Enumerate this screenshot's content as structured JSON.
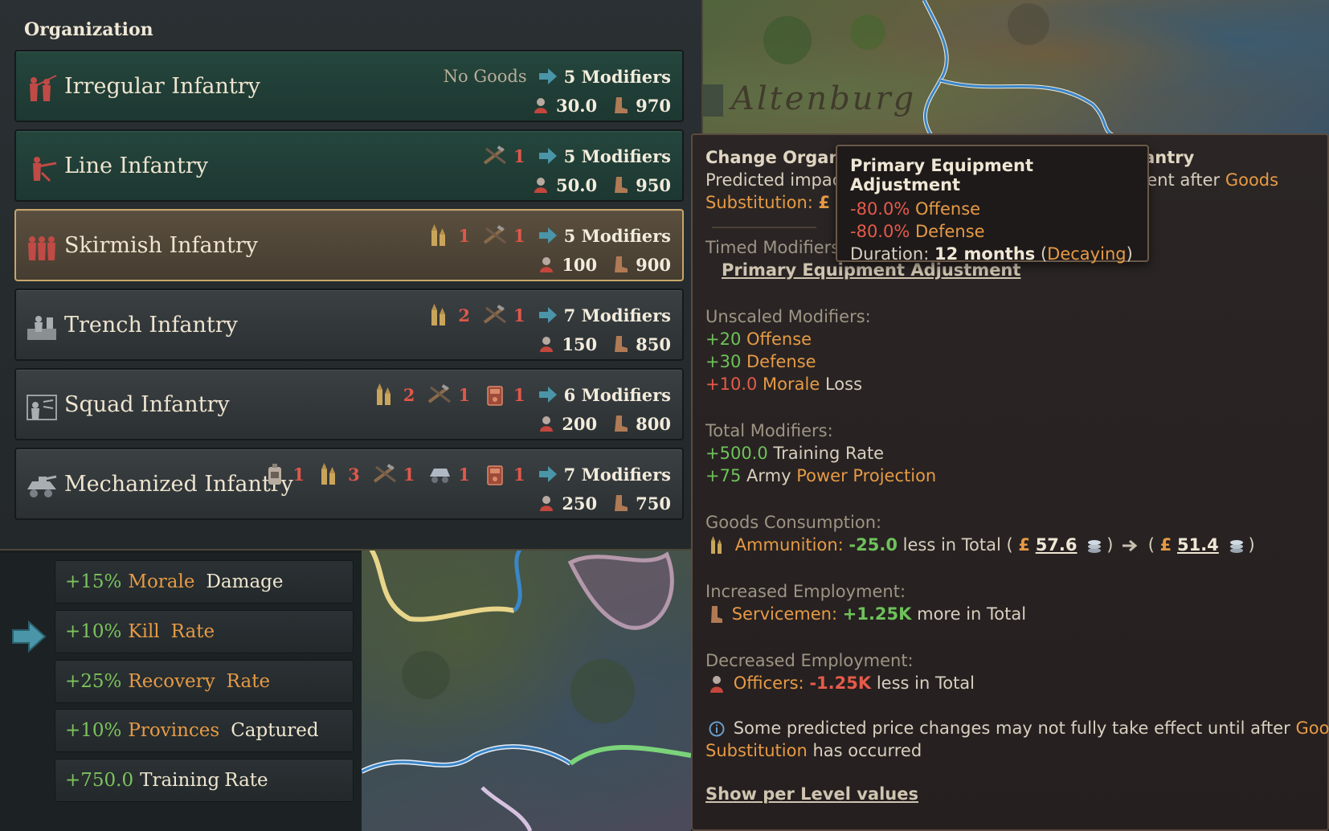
{
  "map": {
    "city_label": "Altenburg"
  },
  "org_panel": {
    "title": "Organization",
    "rows": [
      {
        "name": "Irregular Infantry",
        "no_goods": "No Goods",
        "reqs": [],
        "modifiers": "5 Modifiers",
        "offense": "30.0",
        "manpower": "970"
      },
      {
        "name": "Line Infantry",
        "no_goods": "",
        "reqs": [
          {
            "icon": "rifle-icon",
            "count": "1"
          }
        ],
        "modifiers": "5 Modifiers",
        "offense": "50.0",
        "manpower": "950"
      },
      {
        "name": "Skirmish Infantry",
        "no_goods": "",
        "reqs": [
          {
            "icon": "ammunition-icon",
            "count": "1"
          },
          {
            "icon": "rifle-icon",
            "count": "1"
          }
        ],
        "modifiers": "5 Modifiers",
        "offense": "100",
        "manpower": "900"
      },
      {
        "name": "Trench Infantry",
        "no_goods": "",
        "reqs": [
          {
            "icon": "ammunition-icon",
            "count": "2"
          },
          {
            "icon": "rifle-icon",
            "count": "1"
          }
        ],
        "modifiers": "7 Modifiers",
        "offense": "150",
        "manpower": "850"
      },
      {
        "name": "Squad Infantry",
        "no_goods": "",
        "reqs": [
          {
            "icon": "ammunition-icon",
            "count": "2"
          },
          {
            "icon": "rifle-icon",
            "count": "1"
          },
          {
            "icon": "radio-icon",
            "count": "1"
          }
        ],
        "modifiers": "6 Modifiers",
        "offense": "200",
        "manpower": "800"
      },
      {
        "name": "Mechanized Infantry",
        "no_goods": "",
        "reqs": [
          {
            "icon": "fuel-icon",
            "count": "1"
          },
          {
            "icon": "ammunition-icon",
            "count": "3"
          },
          {
            "icon": "rifle-icon",
            "count": "1"
          },
          {
            "icon": "vehicle-icon",
            "count": "1"
          },
          {
            "icon": "radio-icon",
            "count": "1"
          }
        ],
        "modifiers": "7 Modifiers",
        "offense": "250",
        "manpower": "750"
      }
    ]
  },
  "modifier_list": [
    {
      "value": "+15%",
      "label_a": "Morale",
      "label_b": "Damage"
    },
    {
      "value": "+10%",
      "label_a": "Kill",
      "label_b": "Rate"
    },
    {
      "value": "+25%",
      "label_a": "Recovery",
      "label_b": "Rate"
    },
    {
      "value": "+10%",
      "label_a": "Provinces",
      "label_b": "Captured"
    },
    {
      "value": "+750.0",
      "label_a": "Training",
      "label_b": "Rate"
    }
  ],
  "detail": {
    "title_left": "Change Organiz",
    "title_right": "fantry",
    "predicted_left": "Predicted impac",
    "predicted_right": "nent after",
    "predicted_goods": "Goods",
    "substitution": "Substitution:",
    "pound": "£",
    "timed_header": "Timed Modifiers",
    "timed_link": "Primary Equipment Adjustment",
    "unscaled_header": "Unscaled Modifiers:",
    "unscaled": [
      {
        "value": "+20",
        "label": "Offense"
      },
      {
        "value": "+30",
        "label": "Defense"
      },
      {
        "value": "+10.0",
        "label_a": "Morale",
        "label_b": "Loss"
      }
    ],
    "total_header": "Total Modifiers:",
    "total": [
      {
        "value": "+500.0",
        "label": "Training Rate"
      },
      {
        "value": "+75",
        "label_a": "Army",
        "label_b": "Power Projection"
      }
    ],
    "goods_header": "Goods Consumption:",
    "goods_name": "Ammunition:",
    "goods_value": "-25.0",
    "goods_less": "less in Total (",
    "goods_price_from": "57.6",
    "goods_price_to": "51.4",
    "inc_emp_header": "Increased Employment:",
    "inc_emp_name": "Servicemen:",
    "inc_emp_value": "+1.25K",
    "inc_emp_suffix": "more in Total",
    "dec_emp_header": "Decreased Employment:",
    "dec_emp_name": "Officers:",
    "dec_emp_value": "-1.25K",
    "dec_emp_suffix": "less in Total",
    "note_a": "Some predicted price changes may not fully take effect until after",
    "note_goods": "Goods",
    "note_subst": "Substitution",
    "note_b": "has occurred",
    "show_per_level": "Show per Level values"
  },
  "popup": {
    "title": "Primary Equipment Adjustment",
    "line1_value": "-80.0%",
    "line1_label": "Offense",
    "line2_value": "-80.0%",
    "line2_label": "Defense",
    "duration_label": "Duration:",
    "duration_value": "12 months",
    "duration_state": "Decaying"
  },
  "colors": {
    "green": "#6ec25a",
    "orange": "#e69a45",
    "red": "#e65a4a",
    "selected_border": "#c7a56a"
  }
}
